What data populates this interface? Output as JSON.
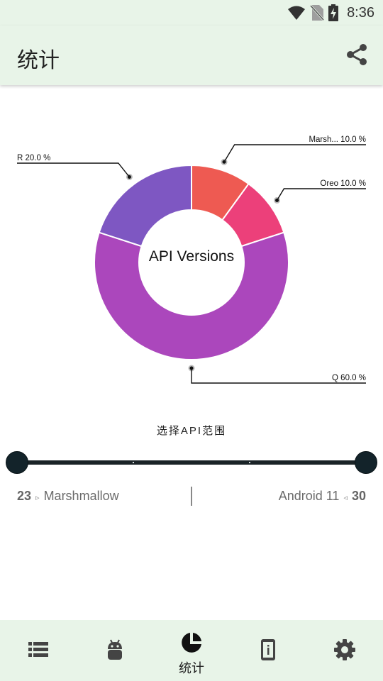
{
  "status_bar": {
    "time": "8:36",
    "icons": [
      "wifi-icon",
      "no-sim-icon",
      "battery-charging-icon"
    ]
  },
  "app_bar": {
    "title": "统计",
    "share_icon": "share-icon"
  },
  "chart_data": {
    "type": "pie",
    "style": "donut",
    "center_text": "API Versions",
    "slices": [
      {
        "label": "Marsh...",
        "value": 10.0,
        "label_text": "Marsh... 10.0 %",
        "color": "#ee5a52"
      },
      {
        "label": "Oreo",
        "value": 10.0,
        "label_text": "Oreo 10.0 %",
        "color": "#ec407a"
      },
      {
        "label": "Q",
        "value": 60.0,
        "label_text": "Q 60.0 %",
        "color": "#ab47bc"
      },
      {
        "label": "R",
        "value": 20.0,
        "label_text": "R 20.0 %",
        "color": "#7e57c2"
      }
    ]
  },
  "range": {
    "label": "选择API范围",
    "min_value": 23,
    "max_value": 30,
    "min_api": "23",
    "min_name": "Marshmallow",
    "max_api": "30",
    "max_name": "Android 11",
    "min_arrow": "▹",
    "max_arrow": "◃"
  },
  "bottom_nav": {
    "items": [
      {
        "icon": "list-icon",
        "label": ""
      },
      {
        "icon": "android-icon",
        "label": ""
      },
      {
        "icon": "pie-chart-icon",
        "label": "统计",
        "active": true
      },
      {
        "icon": "device-info-icon",
        "label": ""
      },
      {
        "icon": "settings-icon",
        "label": ""
      }
    ]
  },
  "colors": {
    "bar_background": "#e8f4e8",
    "slider": "#13232a"
  }
}
